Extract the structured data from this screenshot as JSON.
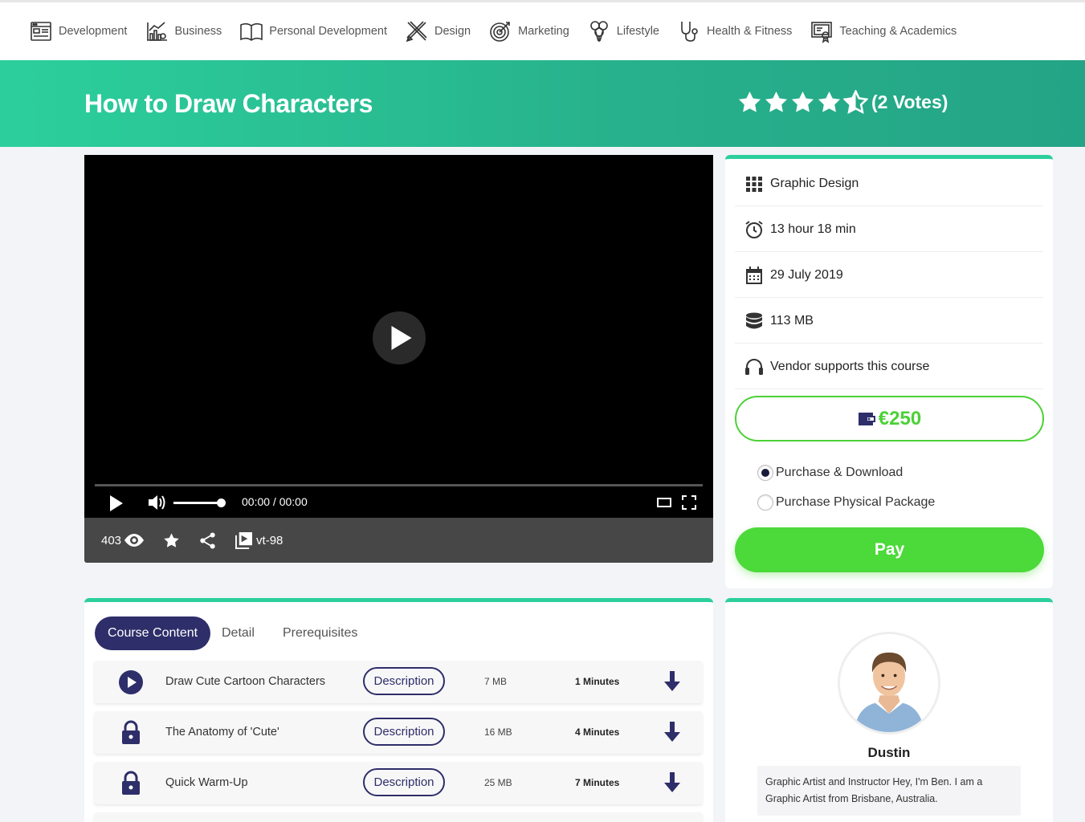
{
  "nav": {
    "items": [
      {
        "label": "Development",
        "icon": "code-window-icon"
      },
      {
        "label": "Business",
        "icon": "bar-chart-icon"
      },
      {
        "label": "Personal Development",
        "icon": "open-book-icon"
      },
      {
        "label": "Design",
        "icon": "pencil-ruler-icon"
      },
      {
        "label": "Marketing",
        "icon": "target-icon"
      },
      {
        "label": "Lifestyle",
        "icon": "balloons-icon"
      },
      {
        "label": "Health & Fitness",
        "icon": "stethoscope-icon"
      },
      {
        "label": "Teaching & Academics",
        "icon": "certificate-icon"
      }
    ]
  },
  "course": {
    "title": "How to Draw Characters",
    "rating": 4.5,
    "votes": "(2 Votes)"
  },
  "player": {
    "time": "00:00 / 00:00",
    "volume": 1.0,
    "views": "403",
    "code": "vt-98"
  },
  "info": {
    "category": "Graphic Design",
    "duration": "13 hour 18 min",
    "date": "29 July 2019",
    "size": "113 MB",
    "support": "Vendor supports this course",
    "price": "€250",
    "options": [
      {
        "label": "Purchase & Download",
        "selected": true
      },
      {
        "label": "Purchase Physical Package",
        "selected": false
      }
    ],
    "pay_label": "Pay"
  },
  "tabs": [
    "Course Content",
    "Detail",
    "Prerequisites"
  ],
  "lessons": [
    {
      "title": "Draw Cute Cartoon Characters",
      "desc": "Description",
      "size": "7 MB",
      "duration": "1 Minutes",
      "locked": false
    },
    {
      "title": "The Anatomy of 'Cute'",
      "desc": "Description",
      "size": "16 MB",
      "duration": "4 Minutes",
      "locked": true
    },
    {
      "title": "Quick Warm-Up",
      "desc": "Description",
      "size": "25 MB",
      "duration": "7 Minutes",
      "locked": true
    }
  ],
  "instructor": {
    "name": "Dustin",
    "bio": "Graphic Artist and Instructor Hey, I'm Ben. I am a Graphic Artist from Brisbane, Australia."
  },
  "colors": {
    "accent": "#2ccf9c",
    "navy": "#2e2e6a",
    "green": "#4cd93a"
  }
}
